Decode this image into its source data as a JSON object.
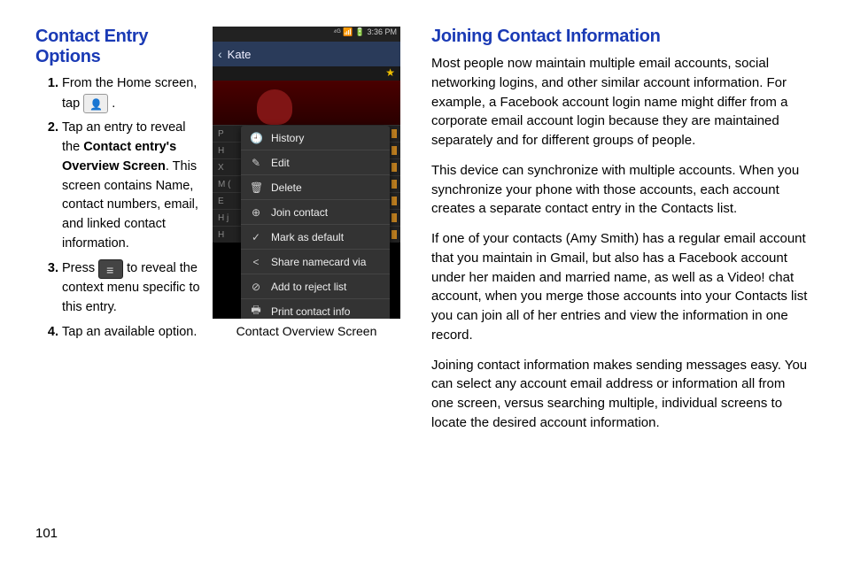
{
  "page_number": "101",
  "left": {
    "title": "Contact Entry Options",
    "steps": {
      "s1a": "From the Home screen, tap ",
      "s1b": ".",
      "s2a": "Tap an entry to reveal the ",
      "s2bold": "Contact entry's Overview Screen",
      "s2b": ". This screen contains Name, contact numbers, email, and linked contact information.",
      "s3a": "Press ",
      "s3b": " to reveal the context menu specific to this entry.",
      "s4": "Tap an available option."
    }
  },
  "screenshot": {
    "status_time": "3:36 PM",
    "status_icons": "⁴ᴳ 📶 🔋",
    "header_name": "Kate",
    "caption": "Contact Overview Screen",
    "tiny_labels": [
      "P",
      "H",
      "X",
      "M (",
      "E",
      "H j",
      "H"
    ],
    "menu_items": [
      {
        "icon": "🕘",
        "label": "History"
      },
      {
        "icon": "✎",
        "label": "Edit"
      },
      {
        "icon": "🗑",
        "label": "Delete"
      },
      {
        "icon": "⊕",
        "label": "Join contact"
      },
      {
        "icon": "✓",
        "label": "Mark as default"
      },
      {
        "icon": "<",
        "label": "Share namecard via"
      },
      {
        "icon": "⊘",
        "label": "Add to reject list"
      },
      {
        "icon": "🖶",
        "label": "Print contact info"
      }
    ]
  },
  "right": {
    "title": "Joining Contact Information",
    "p1": "Most people now maintain multiple email accounts, social networking logins, and other similar account information. For example, a Facebook account login name might differ from a corporate email account login because they are maintained separately and for different groups of people.",
    "p2": "This device can synchronize with multiple accounts. When you synchronize your phone with those accounts, each account creates a separate contact entry in the Contacts list.",
    "p3": "If one of your contacts (Amy Smith) has a regular email account that you maintain in Gmail, but also has a Facebook account under her maiden and married name, as well as a Video! chat account, when you merge those accounts into your Contacts list you can join all of her entries and view the information in one record.",
    "p4": "Joining contact information makes sending messages easy. You can select any account email address or information all from one screen, versus searching multiple, individual screens to locate the desired account information."
  }
}
